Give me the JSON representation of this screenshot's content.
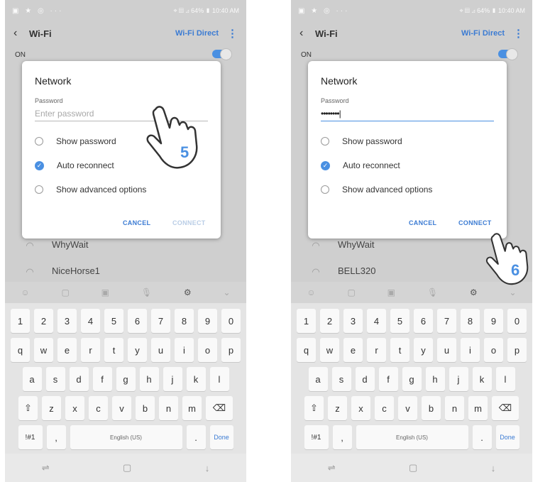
{
  "screens": [
    {
      "status_left": "▣ ★ ◎ ···",
      "status_right": "⌖ ▤ ⊿ 64% ▮ 10:40 AM",
      "back_icon": "‹",
      "title": "Wi-Fi",
      "wifi_direct": "Wi-Fi Direct",
      "more_icon": "⋮",
      "on_label": "ON",
      "dialog": {
        "title": "Network",
        "password_label": "Password",
        "password_value": "",
        "password_placeholder": "Enter password",
        "options": [
          "Show password",
          "Auto reconnect",
          "Show advanced options"
        ],
        "cancel": "CANCEL",
        "connect": "CONNECT"
      },
      "networks": [
        "WhyWait",
        "NiceHorse1"
      ],
      "step": "5"
    },
    {
      "status_left": "▣ ★ ◎ ···",
      "status_right": "⌖ ▤ ⊿ 64% ▮ 10:40 AM",
      "back_icon": "‹",
      "title": "Wi-Fi",
      "wifi_direct": "Wi-Fi Direct",
      "more_icon": "⋮",
      "on_label": "ON",
      "dialog": {
        "title": "Network",
        "password_label": "Password",
        "password_value": "••••••••|",
        "password_placeholder": "",
        "options": [
          "Show password",
          "Auto reconnect",
          "Show advanced options"
        ],
        "cancel": "CANCEL",
        "connect": "CONNECT"
      },
      "networks": [
        "WhyWait",
        "BELL320"
      ],
      "step": "6"
    }
  ],
  "keyboard": {
    "toolbar_icons": [
      "☺",
      "▢",
      "▣",
      "🎙",
      "⚙",
      "⌄"
    ],
    "row_numbers": [
      "1",
      "2",
      "3",
      "4",
      "5",
      "6",
      "7",
      "8",
      "9",
      "0"
    ],
    "row_q": [
      "q",
      "w",
      "e",
      "r",
      "t",
      "y",
      "u",
      "i",
      "o",
      "p"
    ],
    "row_a": [
      "a",
      "s",
      "d",
      "f",
      "g",
      "h",
      "j",
      "k",
      "l"
    ],
    "row_z": [
      "⇧",
      "z",
      "x",
      "c",
      "v",
      "b",
      "n",
      "m",
      "⌫"
    ],
    "sym_key": "!#1",
    "comma_key": ",",
    "space_label": "English (US)",
    "period_key": ".",
    "done_key": "Done",
    "nav_icons": [
      "⇌",
      "▢",
      "↓"
    ]
  },
  "colors": {
    "accent": "#4a90e2",
    "link": "#3b7bd3"
  }
}
